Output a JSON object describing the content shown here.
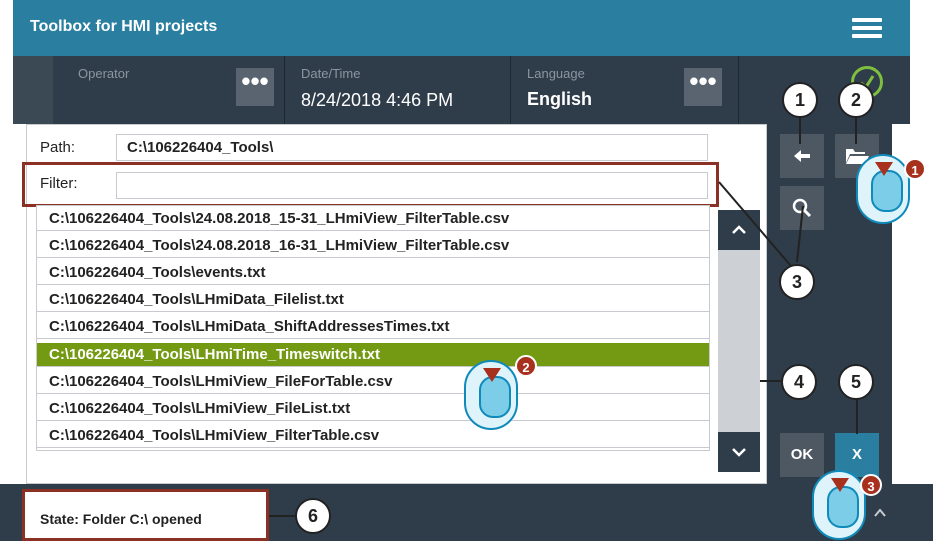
{
  "app": {
    "title": "Toolbox for HMI projects"
  },
  "status_strip": {
    "operator_label": "Operator",
    "datetime_label": "Date/Time",
    "datetime_value": "8/24/2018 4:46 PM",
    "language_label": "Language",
    "language_value": "English",
    "dots": "•••"
  },
  "dialog": {
    "path_label": "Path:",
    "path_value": "C:\\106226404_Tools\\",
    "filter_label": "Filter:",
    "filter_value": "",
    "files": [
      "C:\\106226404_Tools\\24.08.2018_15-31_LHmiView_FilterTable.csv",
      "C:\\106226404_Tools\\24.08.2018_16-31_LHmiView_FilterTable.csv",
      "C:\\106226404_Tools\\events.txt",
      "C:\\106226404_Tools\\LHmiData_Filelist.txt",
      "C:\\106226404_Tools\\LHmiData_ShiftAddressesTimes.txt",
      "C:\\106226404_Tools\\LHmiTime_Timeswitch.txt",
      "C:\\106226404_Tools\\LHmiView_FileForTable.csv",
      "C:\\106226404_Tools\\LHmiView_FileList.txt",
      "C:\\106226404_Tools\\LHmiView_FilterTable.csv"
    ],
    "selected_index": 5,
    "ok_label": "OK",
    "cancel_label": "X"
  },
  "state_bar": {
    "text": "State: Folder C:\\ opened"
  },
  "callouts": [
    "1",
    "2",
    "3",
    "4",
    "5",
    "6"
  ],
  "mouse_badges": [
    "1",
    "2",
    "3"
  ],
  "colors": {
    "accent": "#2a7fa0",
    "panel": "#2f3d4a",
    "selected": "#739a12",
    "callout_red": "#8b3024",
    "ok_green": "#7fbf3f"
  }
}
